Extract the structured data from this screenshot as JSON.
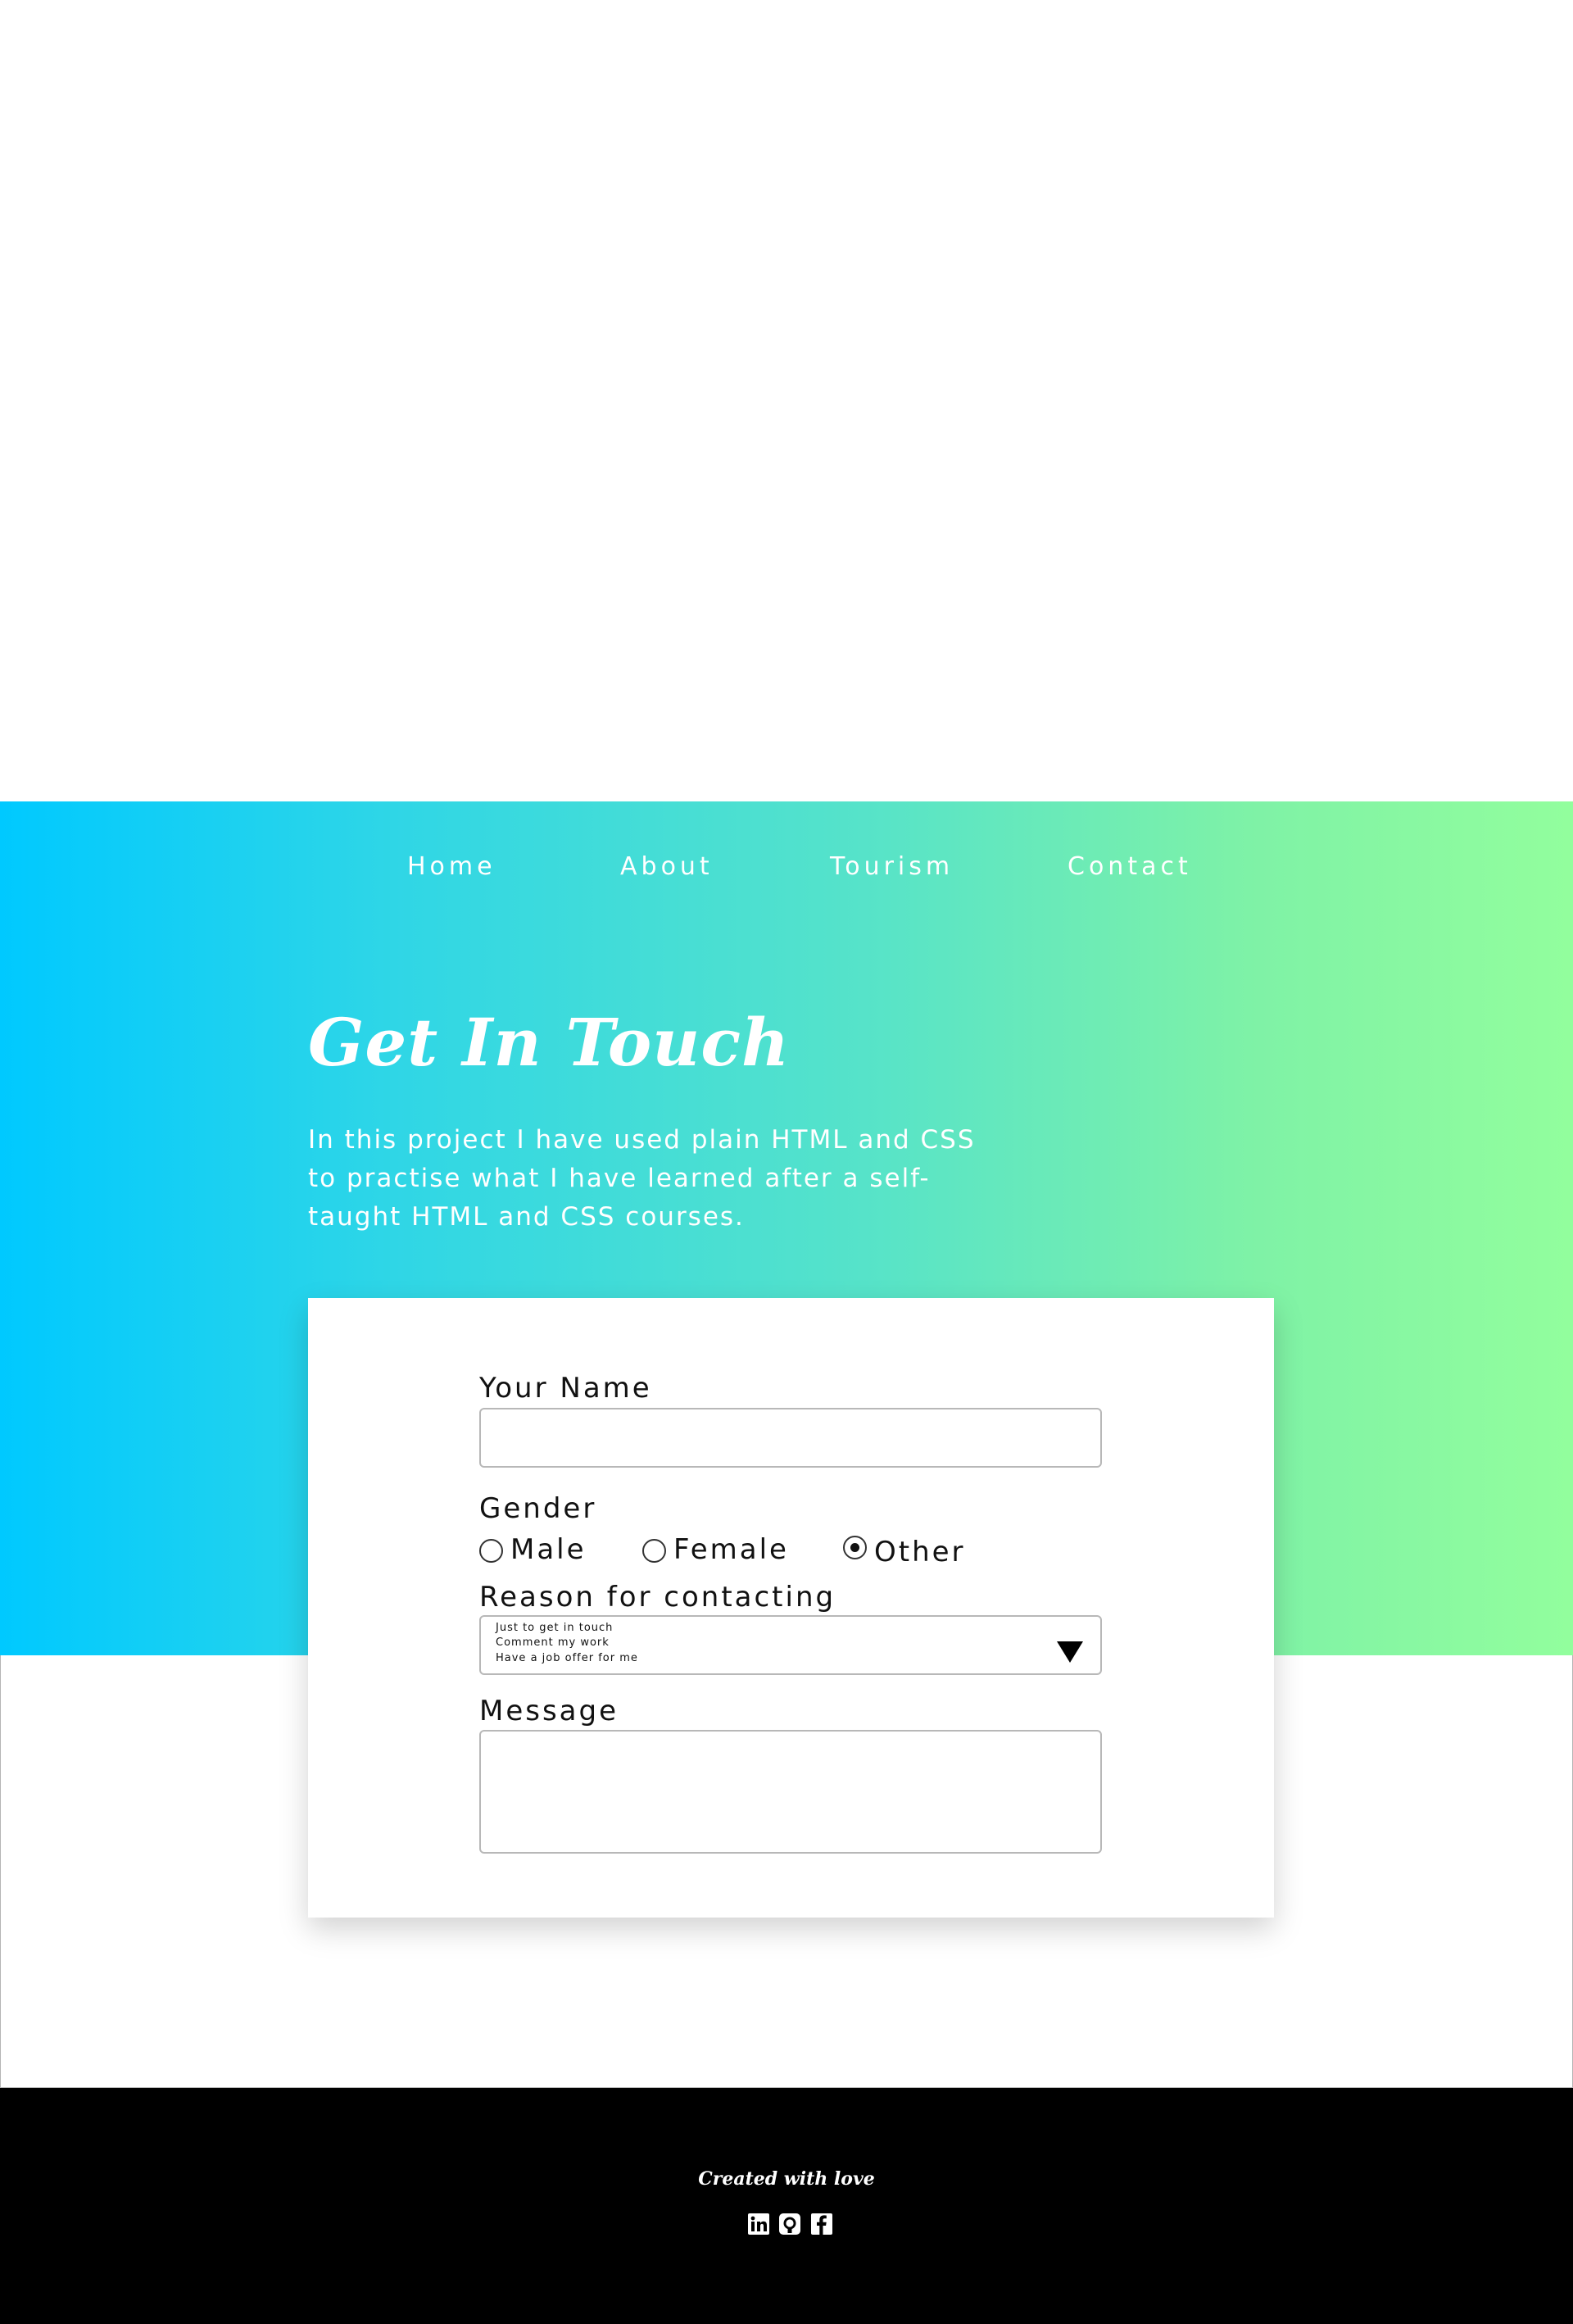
{
  "nav": {
    "items": [
      {
        "label": "Home"
      },
      {
        "label": "About"
      },
      {
        "label": "Tourism"
      },
      {
        "label": "Contact"
      }
    ]
  },
  "hero": {
    "title": "Get In Touch",
    "description": "In this project I have used plain HTML and CSS to practise what I have learned after a self-taught HTML and CSS courses."
  },
  "form": {
    "name_label": "Your Name",
    "name_value": "",
    "gender_label": "Gender",
    "gender_options": [
      {
        "label": "Male",
        "checked": false
      },
      {
        "label": "Female",
        "checked": false
      },
      {
        "label": "Other",
        "checked": true
      }
    ],
    "reason_label": "Reason for contacting",
    "reason_options": [
      "Just to get in touch",
      "Comment my work",
      "Have a job offer for me"
    ],
    "message_label": "Message",
    "message_value": ""
  },
  "footer": {
    "text": "Created with love",
    "icons": [
      "linkedin-icon",
      "github-icon",
      "facebook-icon"
    ]
  },
  "colors": {
    "gradient_start": "#00c9ff",
    "gradient_end": "#92fe9d",
    "footer_bg": "#000000"
  }
}
